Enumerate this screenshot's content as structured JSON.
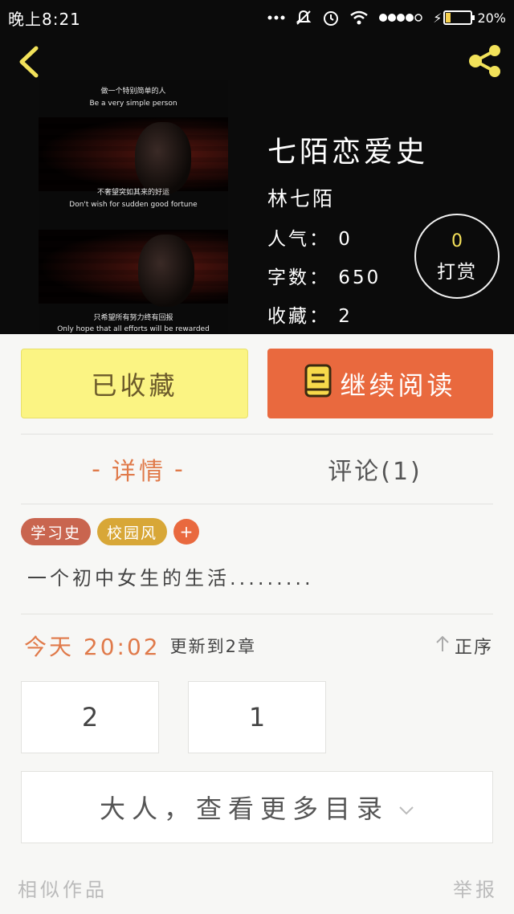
{
  "status_bar": {
    "time": "晚上8:21",
    "battery": "20%",
    "battery_level": 0.2
  },
  "header": {
    "back_icon": "chevron-left-icon",
    "share_icon": "share-icon",
    "cover": {
      "line1_cn": "做一个特别简单的人",
      "line1_en": "Be a very simple person",
      "line2_cn": "不奢望突如其来的好运",
      "line2_en": "Don't wish for sudden good fortune",
      "line3_cn": "只希望所有努力终有回报",
      "line3_en": "Only hope that all efforts will be rewarded"
    },
    "title": "七陌恋爱史",
    "author": "林七陌",
    "popularity": "人气：  0",
    "word_count": "字数：  650",
    "favorites": "收藏：  2",
    "tip": {
      "count": "0",
      "label": "打赏"
    }
  },
  "actions": {
    "collected_label": "已收藏",
    "continue_label": "继续阅读"
  },
  "tabs": {
    "detail": "详情",
    "comment": "评论(1)"
  },
  "tags": [
    {
      "label": "学习史",
      "color": "#c9654f"
    },
    {
      "label": "校园风",
      "color": "#d8a737"
    }
  ],
  "tag_add": "+",
  "description": "一个初中女生的生活.........",
  "update": {
    "time": "今天 20:02",
    "text": "更新到2章",
    "sort_label": "正序"
  },
  "chapters": [
    "2",
    "1"
  ],
  "more_catalog": "大人，查看更多目录",
  "footer": {
    "similar": "相似作品",
    "report": "举报"
  },
  "colors": {
    "accent": "#e9693e",
    "collected_bg": "#fbf483",
    "tip_count": "#f5e15a"
  }
}
